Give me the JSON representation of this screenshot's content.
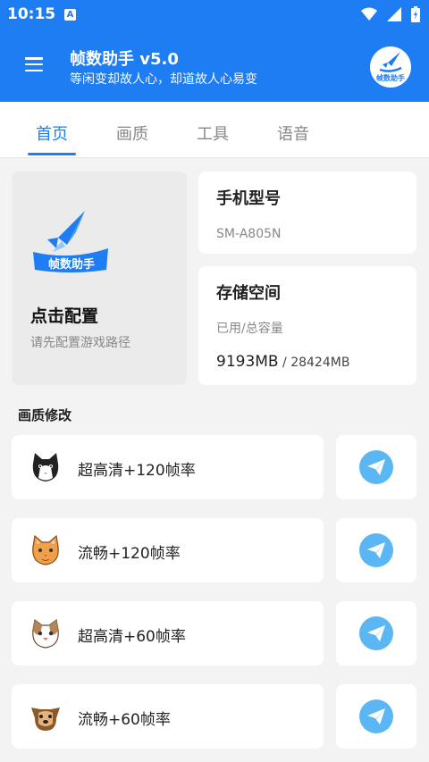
{
  "status": {
    "time": "10:15",
    "badge": "A"
  },
  "app": {
    "title": "帧数助手 v5.0",
    "subtitle": "等闲变却故人心，却道故人心易变",
    "logo_text": "帧数助手"
  },
  "tabs": [
    "首页",
    "画质",
    "工具",
    "语音"
  ],
  "config": {
    "title": "点击配置",
    "subtitle": "请先配置游戏路径",
    "logo_text": "帧数助手"
  },
  "phone": {
    "title": "手机型号",
    "model": "SM-A805N"
  },
  "storage": {
    "title": "存储空间",
    "label": "已用/总容量",
    "used": "9193MB",
    "total": " / 28424MB"
  },
  "section": "画质修改",
  "quality_items": [
    {
      "label": "超高清+120帧率",
      "icon": "black-white-cat-icon"
    },
    {
      "label": "流畅+120帧率",
      "icon": "orange-cat-icon"
    },
    {
      "label": "超高清+60帧率",
      "icon": "brown-white-cat-icon"
    },
    {
      "label": "流畅+60帧率",
      "icon": "dog-icon"
    }
  ],
  "colors": {
    "primary": "#1e7df3",
    "send": "#5bb7f3",
    "background": "#f3f3f3"
  }
}
